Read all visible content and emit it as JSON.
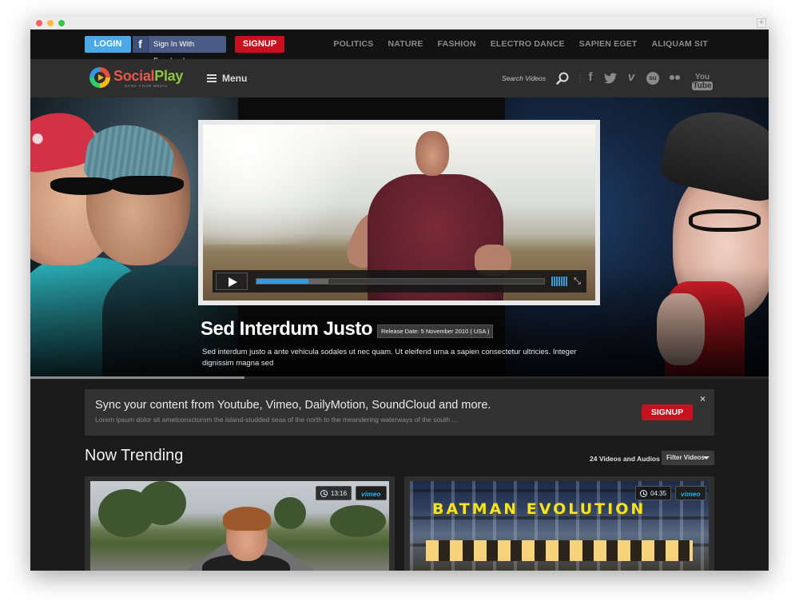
{
  "topbar": {
    "login_label": "LOGIN",
    "facebook_label": "Sign In With Facebook",
    "signup_label": "SIGNUP",
    "nav": [
      "POLITICS",
      "NATURE",
      "FASHION",
      "ELECTRO DANCE",
      "SAPIEN EGET",
      "ALIQUAM SIT"
    ]
  },
  "header": {
    "logo_part1": "Social",
    "logo_part2": "Play",
    "logo_tagline": "SYNC YOUR MEDIA",
    "menu_label": "Menu",
    "search_label": "Search Videos",
    "social_icons": [
      "facebook-icon",
      "twitter-icon",
      "vimeo-icon",
      "stumbleupon-icon",
      "flickr-icon",
      "youtube-icon"
    ],
    "youtube_you": "You",
    "youtube_tube": "Tube"
  },
  "hero": {
    "title": "Sed Interdum Justo",
    "release": "Release Date: 5 November 2010 ( USA )",
    "description": "Sed interdum justo a ante vehicula sodales ut nec quam. Ut eleifend urna a sapien consectetur ultricies. Integer dignissim magna sed",
    "video_progress": 0.18,
    "video_buffered": 0.25,
    "slider_progress": 0.29
  },
  "promo": {
    "title": "Sync your content from Youtube, Vimeo, DailyMotion, SoundCloud and more.",
    "subtitle": "Lorem ipsum dolor sit ametconscturom the island-studded seas of the north to the meandering waterways of the south ...",
    "signup_label": "SIGNUP",
    "close_label": "×"
  },
  "trending": {
    "title": "Now Trending",
    "count_label": "24 Videos and Audios",
    "filter_label": "Filter Videos",
    "cards": [
      {
        "duration": "13:16",
        "source": "vimeo",
        "overlay_text": ""
      },
      {
        "duration": "04:35",
        "source": "vimeo",
        "overlay_text": "BATMAN EVOLUTION"
      }
    ]
  },
  "colors": {
    "login_blue": "#4aa9e6",
    "signup_red": "#c8101e",
    "facebook_blue": "#4a5c86",
    "progress_blue": "#3a9ad9",
    "vimeo_blue": "#1ab7ea"
  }
}
